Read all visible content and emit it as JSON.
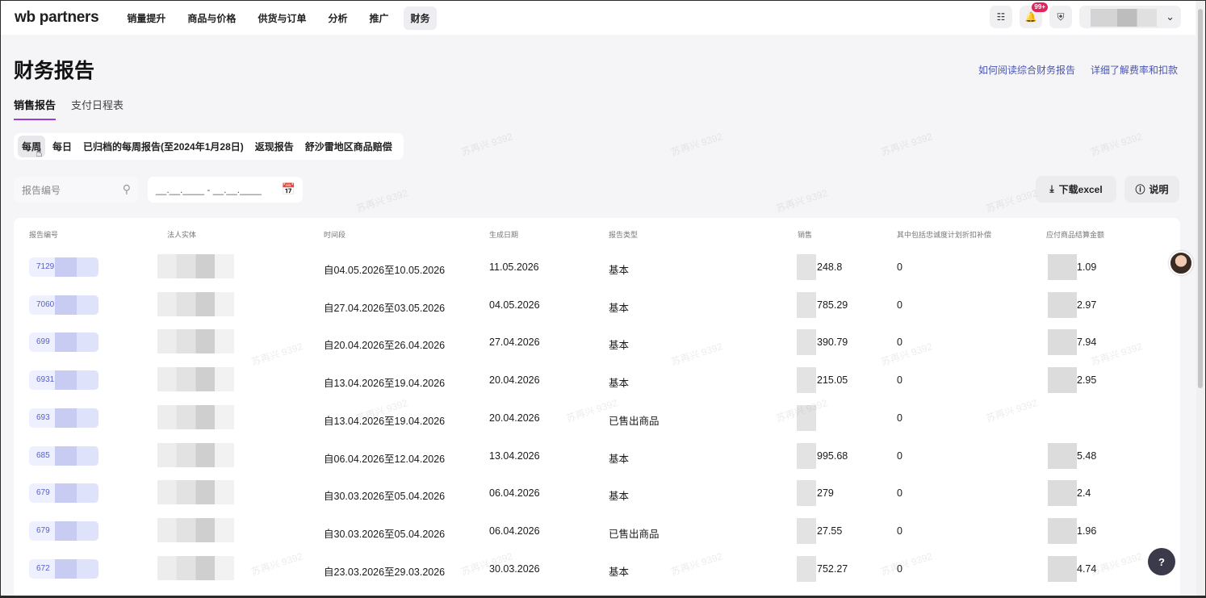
{
  "nav": {
    "logo": "wb partners",
    "items": [
      "销量提升",
      "商品与价格",
      "供货与订单",
      "分析",
      "推广",
      "财务"
    ],
    "active_index": 5,
    "notification_badge": "99+"
  },
  "header": {
    "title": "财务报告",
    "links": [
      "如何阅读综合财务报告",
      "详细了解费率和扣款"
    ]
  },
  "tabs": [
    {
      "label": "销售报告",
      "active": true
    },
    {
      "label": "支付日程表",
      "active": false
    }
  ],
  "filters": [
    "每周",
    "每日",
    "已归档的每周报告(至2024年1月28日)",
    "返现报告",
    "舒沙雷地区商品赔偿"
  ],
  "search": {
    "placeholder": "报告编号"
  },
  "daterange": {
    "value": "__.__.____ - __.__.____"
  },
  "actions": {
    "download": "下载excel",
    "help": "说明"
  },
  "table": {
    "columns": [
      "报告编号",
      "法人实体",
      "时间段",
      "生成日期",
      "报告类型",
      "销售",
      "其中包括忠诚度计划折扣补偿",
      "应付商品结算金额"
    ],
    "rows": [
      {
        "id": "7129",
        "period": "自04.05.2026至10.05.2026",
        "date": "11.05.2026",
        "type": "基本",
        "sales": "248.8",
        "loyalty": "0",
        "payable": "1.09"
      },
      {
        "id": "7060",
        "period": "自27.04.2026至03.05.2026",
        "date": "04.05.2026",
        "type": "基本",
        "sales": "785.29",
        "loyalty": "0",
        "payable": "2.97"
      },
      {
        "id": "699",
        "period": "自20.04.2026至26.04.2026",
        "date": "27.04.2026",
        "type": "基本",
        "sales": "390.79",
        "loyalty": "0",
        "payable": "7.94"
      },
      {
        "id": "6931",
        "period": "自13.04.2026至19.04.2026",
        "date": "20.04.2026",
        "type": "基本",
        "sales": "215.05",
        "loyalty": "0",
        "payable": "2.95"
      },
      {
        "id": "693",
        "period": "自13.04.2026至19.04.2026",
        "date": "20.04.2026",
        "type": "已售出商品",
        "sales": "",
        "loyalty": "0",
        "payable": ""
      },
      {
        "id": "685",
        "period": "自06.04.2026至12.04.2026",
        "date": "13.04.2026",
        "type": "基本",
        "sales": "995.68",
        "loyalty": "0",
        "payable": "5.48"
      },
      {
        "id": "679",
        "period": "自30.03.2026至05.04.2026",
        "date": "06.04.2026",
        "type": "基本",
        "sales": "279",
        "loyalty": "0",
        "payable": "2.4"
      },
      {
        "id": "679",
        "period": "自30.03.2026至05.04.2026",
        "date": "06.04.2026",
        "type": "已售出商品",
        "sales": "27.55",
        "loyalty": "0",
        "payable": "1.96"
      },
      {
        "id": "672",
        "period": "自23.03.2026至29.03.2026",
        "date": "30.03.2026",
        "type": "基本",
        "sales": "752.27",
        "loyalty": "0",
        "payable": "4.74"
      }
    ]
  },
  "watermark": "苏再兴 9392",
  "fab": {
    "help": "?"
  },
  "colors": {
    "accent": "#9a3dd8",
    "link": "#4a55b0",
    "badge": "#e0245e"
  }
}
